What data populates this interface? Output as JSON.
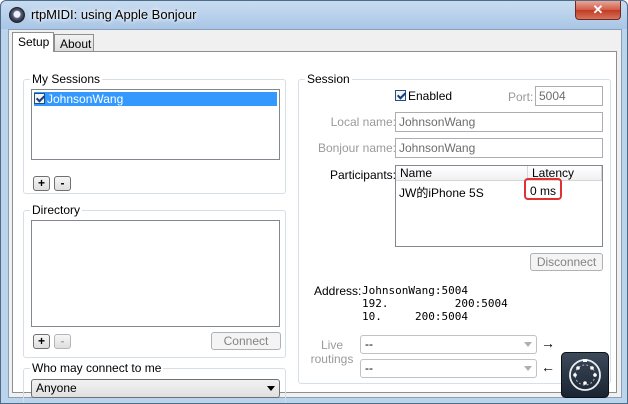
{
  "window": {
    "title": "rtpMIDI: using Apple Bonjour",
    "close_glyph": "✕"
  },
  "tabs": [
    {
      "label": "Setup",
      "active": true
    },
    {
      "label": "About",
      "active": false
    }
  ],
  "my_sessions": {
    "legend": "My Sessions",
    "items": [
      {
        "label": "JohnsonWang",
        "checked": true,
        "selected": true
      }
    ],
    "add_label": "+",
    "remove_label": "-"
  },
  "directory": {
    "legend": "Directory",
    "items": [],
    "add_label": "+",
    "remove_label": "-",
    "connect_label": "Connect"
  },
  "who_may_connect": {
    "legend": "Who may connect to me",
    "value": "Anyone"
  },
  "session": {
    "legend": "Session",
    "enabled_label": "Enabled",
    "enabled": true,
    "port_label": "Port:",
    "port_value": "5004",
    "local_name_label": "Local name:",
    "local_name_value": "JohnsonWang",
    "bonjour_name_label": "Bonjour name:",
    "bonjour_name_value": "JohnsonWang",
    "participants_label": "Participants:",
    "participants_columns": {
      "name": "Name",
      "latency": "Latency"
    },
    "participants": [
      {
        "name": "JW的iPhone 5S",
        "latency": "0 ms"
      }
    ],
    "disconnect_label": "Disconnect",
    "address_label": "Address:",
    "address_lines": [
      "JohnsonWang:5004",
      "192.          200:5004",
      "10.     200:5004"
    ],
    "live_routings_label": "Live\nroutings",
    "routing_in_value": "--",
    "routing_out_value": "--",
    "routing_in_arrow": "→",
    "routing_out_arrow": "←"
  },
  "colors": {
    "selection": "#3399ff",
    "highlight": "#e03030",
    "title_bar": "#a9c6e6"
  },
  "icons": {
    "app": "rtpmidi-app-icon",
    "midi": "midi-port-icon"
  }
}
